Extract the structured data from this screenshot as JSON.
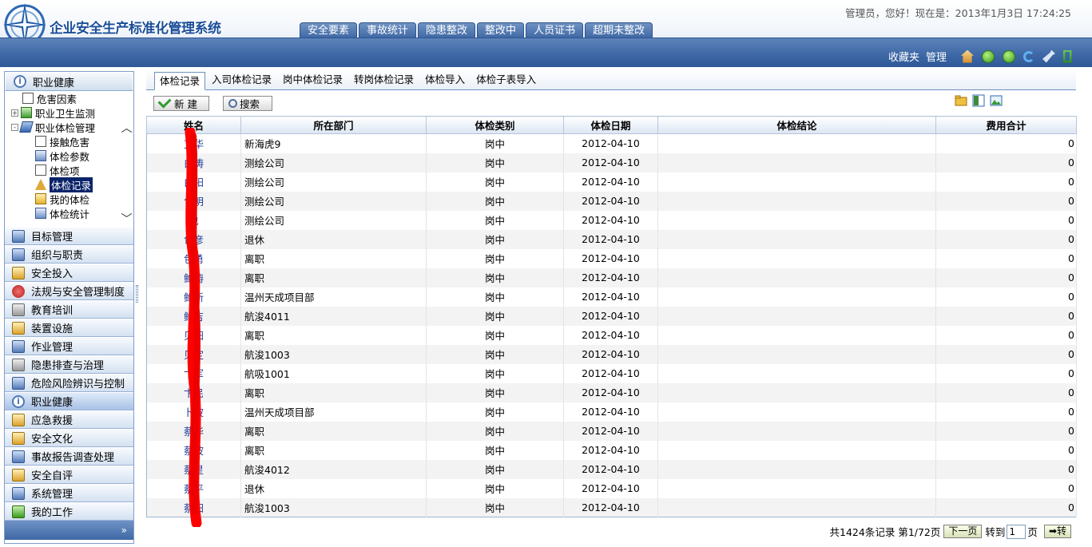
{
  "header": {
    "app_title": "企业安全生产标准化管理系统",
    "status_text": "管理员，您好！现在是：2013年1月3日  17:24:25",
    "top_tabs": [
      "安全要素",
      "事故统计",
      "隐患整改",
      "整改中",
      "人员证书",
      "超期未整改"
    ],
    "links": {
      "favorites": "收藏夹",
      "manage": "管理"
    }
  },
  "sidebar": {
    "tree_title": "职业健康",
    "tree": [
      {
        "label": "危害因素",
        "icon": "document-icon"
      },
      {
        "label": "职业卫生监测",
        "icon": "list-icon",
        "toggle": "+"
      },
      {
        "label": "职业体检管理",
        "icon": "book-icon",
        "toggle": "-"
      },
      {
        "label": "接触危害",
        "icon": "document-icon"
      },
      {
        "label": "体检参数",
        "icon": "parameter-icon"
      },
      {
        "label": "体检项",
        "icon": "grid-icon"
      },
      {
        "label": "体检记录",
        "icon": "warning-icon",
        "selected": true
      },
      {
        "label": "我的体检",
        "icon": "folder-icon"
      },
      {
        "label": "体检统计",
        "icon": "report-icon"
      }
    ],
    "menu": [
      {
        "label": "目标管理",
        "icon": "target-icon"
      },
      {
        "label": "组织与职责",
        "icon": "organization-icon"
      },
      {
        "label": "安全投入",
        "icon": "investment-icon"
      },
      {
        "label": "法规与安全管理制度",
        "icon": "regulation-icon"
      },
      {
        "label": "教育培训",
        "icon": "training-icon"
      },
      {
        "label": "装置设施",
        "icon": "facility-icon"
      },
      {
        "label": "作业管理",
        "icon": "worker-icon"
      },
      {
        "label": "隐患排查与治理",
        "icon": "hazard-icon"
      },
      {
        "label": "危险风险辨识与控制",
        "icon": "risk-icon"
      },
      {
        "label": "职业健康",
        "icon": "info-icon",
        "active": true
      },
      {
        "label": "应急救援",
        "icon": "emergency-icon"
      },
      {
        "label": "安全文化",
        "icon": "culture-icon"
      },
      {
        "label": "事故报告调查处理",
        "icon": "accident-icon"
      },
      {
        "label": "安全自评",
        "icon": "self-assessment-icon"
      },
      {
        "label": "系统管理",
        "icon": "system-icon"
      },
      {
        "label": "我的工作",
        "icon": "work-icon"
      }
    ],
    "collapse_glyph": "»"
  },
  "main": {
    "sub_tabs": [
      "体检记录",
      "入司体检记录",
      "岗中体检记录",
      "转岗体检记录",
      "体检导入",
      "体检子表导入"
    ],
    "toolbar": {
      "new_label": "新 建",
      "search_label": "搜索"
    },
    "columns": [
      "姓名",
      "所在部门",
      "体检类别",
      "体检日期",
      "体检结论",
      "费用合计"
    ],
    "rows": [
      {
        "name": "艾华",
        "dept": "新海虎9",
        "type": "岗中",
        "date": "2012-04-10",
        "conclusion": "",
        "cost": "0"
      },
      {
        "name": "白涛",
        "dept": "测绘公司",
        "type": "岗中",
        "date": "2012-04-10",
        "conclusion": "",
        "cost": "0"
      },
      {
        "name": "白阳",
        "dept": "测绘公司",
        "type": "岗中",
        "date": "2012-04-10",
        "conclusion": "",
        "cost": "0"
      },
      {
        "name": "包明",
        "dept": "测绘公司",
        "type": "岗中",
        "date": "2012-04-10",
        "conclusion": "",
        "cost": "0"
      },
      {
        "name": "包",
        "dept": "测绘公司",
        "type": "岗中",
        "date": "2012-04-10",
        "conclusion": "",
        "cost": "0"
      },
      {
        "name": "包彦",
        "dept": "退休",
        "type": "岗中",
        "date": "2012-04-10",
        "conclusion": "",
        "cost": "0"
      },
      {
        "name": "包勇",
        "dept": "离职",
        "type": "岗中",
        "date": "2012-04-10",
        "conclusion": "",
        "cost": "0"
      },
      {
        "name": "鲍涛",
        "dept": "离职",
        "type": "岗中",
        "date": "2012-04-10",
        "conclusion": "",
        "cost": "0"
      },
      {
        "name": "鲍新",
        "dept": "温州天成项目部",
        "type": "岗中",
        "date": "2012-04-10",
        "conclusion": "",
        "cost": "0"
      },
      {
        "name": "鲍吉",
        "dept": "航浚4011",
        "type": "岗中",
        "date": "2012-04-10",
        "conclusion": "",
        "cost": "0"
      },
      {
        "name": "贝阳",
        "dept": "离职",
        "type": "岗中",
        "date": "2012-04-10",
        "conclusion": "",
        "cost": "0"
      },
      {
        "name": "贝定",
        "dept": "航浚1003",
        "type": "岗中",
        "date": "2012-04-10",
        "conclusion": "",
        "cost": "0"
      },
      {
        "name": "卞军",
        "dept": "航吸1001",
        "type": "岗中",
        "date": "2012-04-10",
        "conclusion": "",
        "cost": "0"
      },
      {
        "name": "卞民",
        "dept": "离职",
        "type": "岗中",
        "date": "2012-04-10",
        "conclusion": "",
        "cost": "0"
      },
      {
        "name": "卜波",
        "dept": "温州天成项目部",
        "type": "岗中",
        "date": "2012-04-10",
        "conclusion": "",
        "cost": "0"
      },
      {
        "name": "蔡华",
        "dept": "离职",
        "type": "岗中",
        "date": "2012-04-10",
        "conclusion": "",
        "cost": "0"
      },
      {
        "name": "蔡波",
        "dept": "离职",
        "type": "岗中",
        "date": "2012-04-10",
        "conclusion": "",
        "cost": "0"
      },
      {
        "name": "蔡星",
        "dept": "航浚4012",
        "type": "岗中",
        "date": "2012-04-10",
        "conclusion": "",
        "cost": "0"
      },
      {
        "name": "蔡平",
        "dept": "退休",
        "type": "岗中",
        "date": "2012-04-10",
        "conclusion": "",
        "cost": "0"
      },
      {
        "name": "蔡阳",
        "dept": "航浚1003",
        "type": "岗中",
        "date": "2012-04-10",
        "conclusion": "",
        "cost": "0"
      }
    ]
  },
  "pager": {
    "summary": "共1424条记录 第1/72页",
    "next_label": "下一页",
    "goto_prefix": "转到",
    "page_value": "1",
    "goto_suffix": "页",
    "go_label": "➡转"
  },
  "colors": {
    "header_blue": "#3f69a7",
    "link_blue": "#1d3d9a",
    "selected_bg": "#0a246a",
    "redaction": "#ff0000"
  }
}
